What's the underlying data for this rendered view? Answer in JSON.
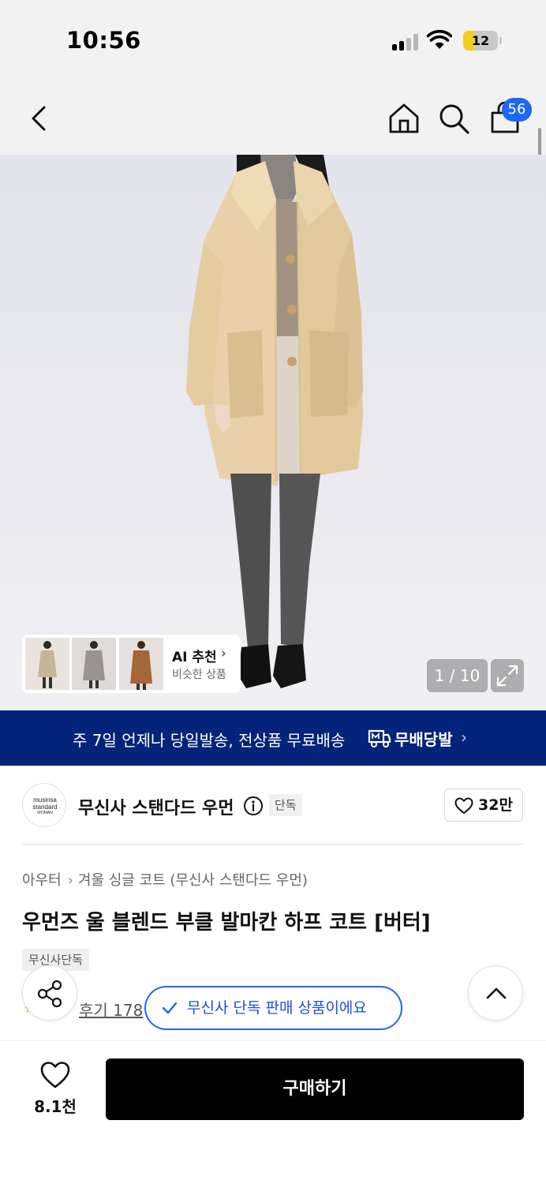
{
  "status_bar": {
    "time": "10:56",
    "battery_level": "12",
    "icons": [
      "cellular-signal-icon",
      "wifi-icon",
      "battery-icon"
    ]
  },
  "nav": {
    "icons": [
      "back-icon",
      "home-icon",
      "search-icon",
      "cart-icon"
    ],
    "cart_count": "56"
  },
  "gallery": {
    "ai_recommend_title": "AI 추천",
    "ai_recommend_subtitle": "비슷한 상품",
    "image_counter": "1 / 10"
  },
  "delivery_banner": {
    "text": "주 7일 언제나 당일발송, 전상품 무료배송",
    "brand": "무배당발",
    "colors": {
      "background": "#04237a"
    }
  },
  "brand": {
    "logo_text_line1": "musinsa",
    "logo_text_line2": "standard",
    "logo_text_line3": "WOMAN",
    "name": "무신사 스탠다드 우먼",
    "tag": "단독",
    "follow_count": "32만"
  },
  "product": {
    "breadcrumb": [
      "아우터",
      "겨울 싱글 코트 (무신사 스탠다드 우먼)"
    ],
    "title": "우먼즈 울 블렌드 부클 발마칸 하프 코트 [버터]",
    "tag": "무신사단독",
    "review_link": "후기 178"
  },
  "toast": {
    "text": "무신사 단독 판매 상품이에요",
    "colors": {
      "accent": "#1e66f5"
    }
  },
  "bottom_bar": {
    "like_count": "8.1천",
    "buy_label": "구매하기"
  }
}
